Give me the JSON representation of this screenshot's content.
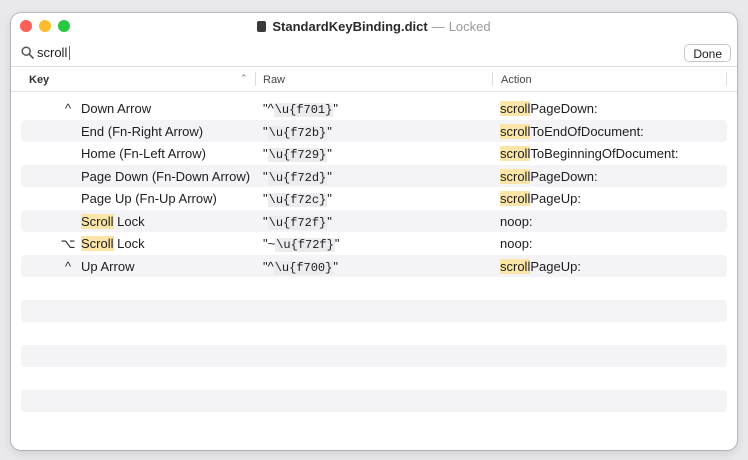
{
  "window": {
    "file_name": "StandardKeyBinding.dict",
    "separator": "—",
    "status": "Locked"
  },
  "search": {
    "value": "scroll",
    "done_label": "Done"
  },
  "columns": {
    "key": "Key",
    "raw": "Raw",
    "action": "Action"
  },
  "rows": [
    {
      "mod": "^",
      "hl": "",
      "key": "Down Arrow",
      "raw_pre": "\"^",
      "raw_code": "\\u{f701}",
      "raw_post": "\"",
      "act_hl": "scroll",
      "act": "PageDown:"
    },
    {
      "mod": "",
      "hl": "",
      "key": "End (Fn-Right Arrow)",
      "raw_pre": "\"",
      "raw_code": "\\u{f72b}",
      "raw_post": "\"",
      "act_hl": "scroll",
      "act": "ToEndOfDocument:"
    },
    {
      "mod": "",
      "hl": "",
      "key": "Home (Fn-Left Arrow)",
      "raw_pre": "\"",
      "raw_code": "\\u{f729}",
      "raw_post": "\"",
      "act_hl": "scroll",
      "act": "ToBeginningOfDocument:"
    },
    {
      "mod": "",
      "hl": "",
      "key": "Page Down (Fn-Down Arrow)",
      "raw_pre": "\"",
      "raw_code": "\\u{f72d}",
      "raw_post": "\"",
      "act_hl": "scroll",
      "act": "PageDown:"
    },
    {
      "mod": "",
      "hl": "",
      "key": "Page Up (Fn-Up Arrow)",
      "raw_pre": "\"",
      "raw_code": "\\u{f72c}",
      "raw_post": "\"",
      "act_hl": "scroll",
      "act": "PageUp:"
    },
    {
      "mod": "",
      "hl": "Scroll",
      "key": " Lock",
      "raw_pre": "\"",
      "raw_code": "\\u{f72f}",
      "raw_post": "\"",
      "act_hl": "",
      "act": "noop:"
    },
    {
      "mod": "⌥",
      "hl": "Scroll",
      "key": " Lock",
      "raw_pre": "\"~",
      "raw_code": "\\u{f72f}",
      "raw_post": "\"",
      "act_hl": "",
      "act": "noop:"
    },
    {
      "mod": "^",
      "hl": "",
      "key": "Up Arrow",
      "raw_pre": "\"^",
      "raw_code": "\\u{f700}",
      "raw_post": "\"",
      "act_hl": "scroll",
      "act": "PageUp:"
    }
  ]
}
